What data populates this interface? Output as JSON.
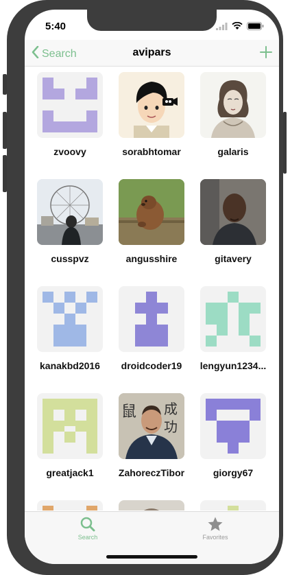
{
  "status": {
    "time": "5:40"
  },
  "nav": {
    "back_label": "Search",
    "title": "avipars"
  },
  "users": [
    {
      "name": "zvoovy"
    },
    {
      "name": "sorabhtomar"
    },
    {
      "name": "galaris"
    },
    {
      "name": "cusspvz"
    },
    {
      "name": "angusshire"
    },
    {
      "name": "gitavery"
    },
    {
      "name": "kanakbd2016"
    },
    {
      "name": "droidcoder19"
    },
    {
      "name": "lengyun1234..."
    },
    {
      "name": "greatjack1"
    },
    {
      "name": "ZahoreczTibor"
    },
    {
      "name": "giorgy67"
    }
  ],
  "tabs": [
    {
      "label": "Search",
      "active": true
    },
    {
      "label": "Favorites",
      "active": false
    }
  ],
  "colors": {
    "accent": "#7cbf8e",
    "inactive_tab": "#9a9a9a"
  }
}
